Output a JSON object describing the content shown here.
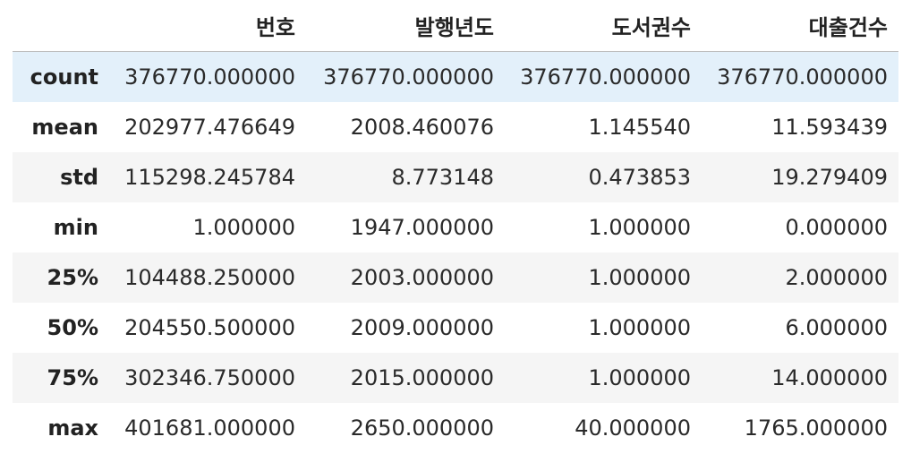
{
  "table": {
    "index_header": "",
    "columns": [
      "번호",
      "발행년도",
      "도서권수",
      "대출건수"
    ],
    "rows": [
      {
        "index": "count",
        "values": [
          "376770.000000",
          "376770.000000",
          "376770.000000",
          "376770.000000"
        ]
      },
      {
        "index": "mean",
        "values": [
          "202977.476649",
          "2008.460076",
          "1.145540",
          "11.593439"
        ]
      },
      {
        "index": "std",
        "values": [
          "115298.245784",
          "8.773148",
          "0.473853",
          "19.279409"
        ]
      },
      {
        "index": "min",
        "values": [
          "1.000000",
          "1947.000000",
          "1.000000",
          "0.000000"
        ]
      },
      {
        "index": "25%",
        "values": [
          "104488.250000",
          "2003.000000",
          "1.000000",
          "2.000000"
        ]
      },
      {
        "index": "50%",
        "values": [
          "204550.500000",
          "2009.000000",
          "1.000000",
          "6.000000"
        ]
      },
      {
        "index": "75%",
        "values": [
          "302346.750000",
          "2015.000000",
          "1.000000",
          "14.000000"
        ]
      },
      {
        "index": "max",
        "values": [
          "401681.000000",
          "2650.000000",
          "40.000000",
          "1765.000000"
        ]
      }
    ]
  },
  "colors": {
    "hover_row": "#e3f0fa",
    "striped_row": "#f5f5f5",
    "header_border": "#bdbdbd"
  }
}
